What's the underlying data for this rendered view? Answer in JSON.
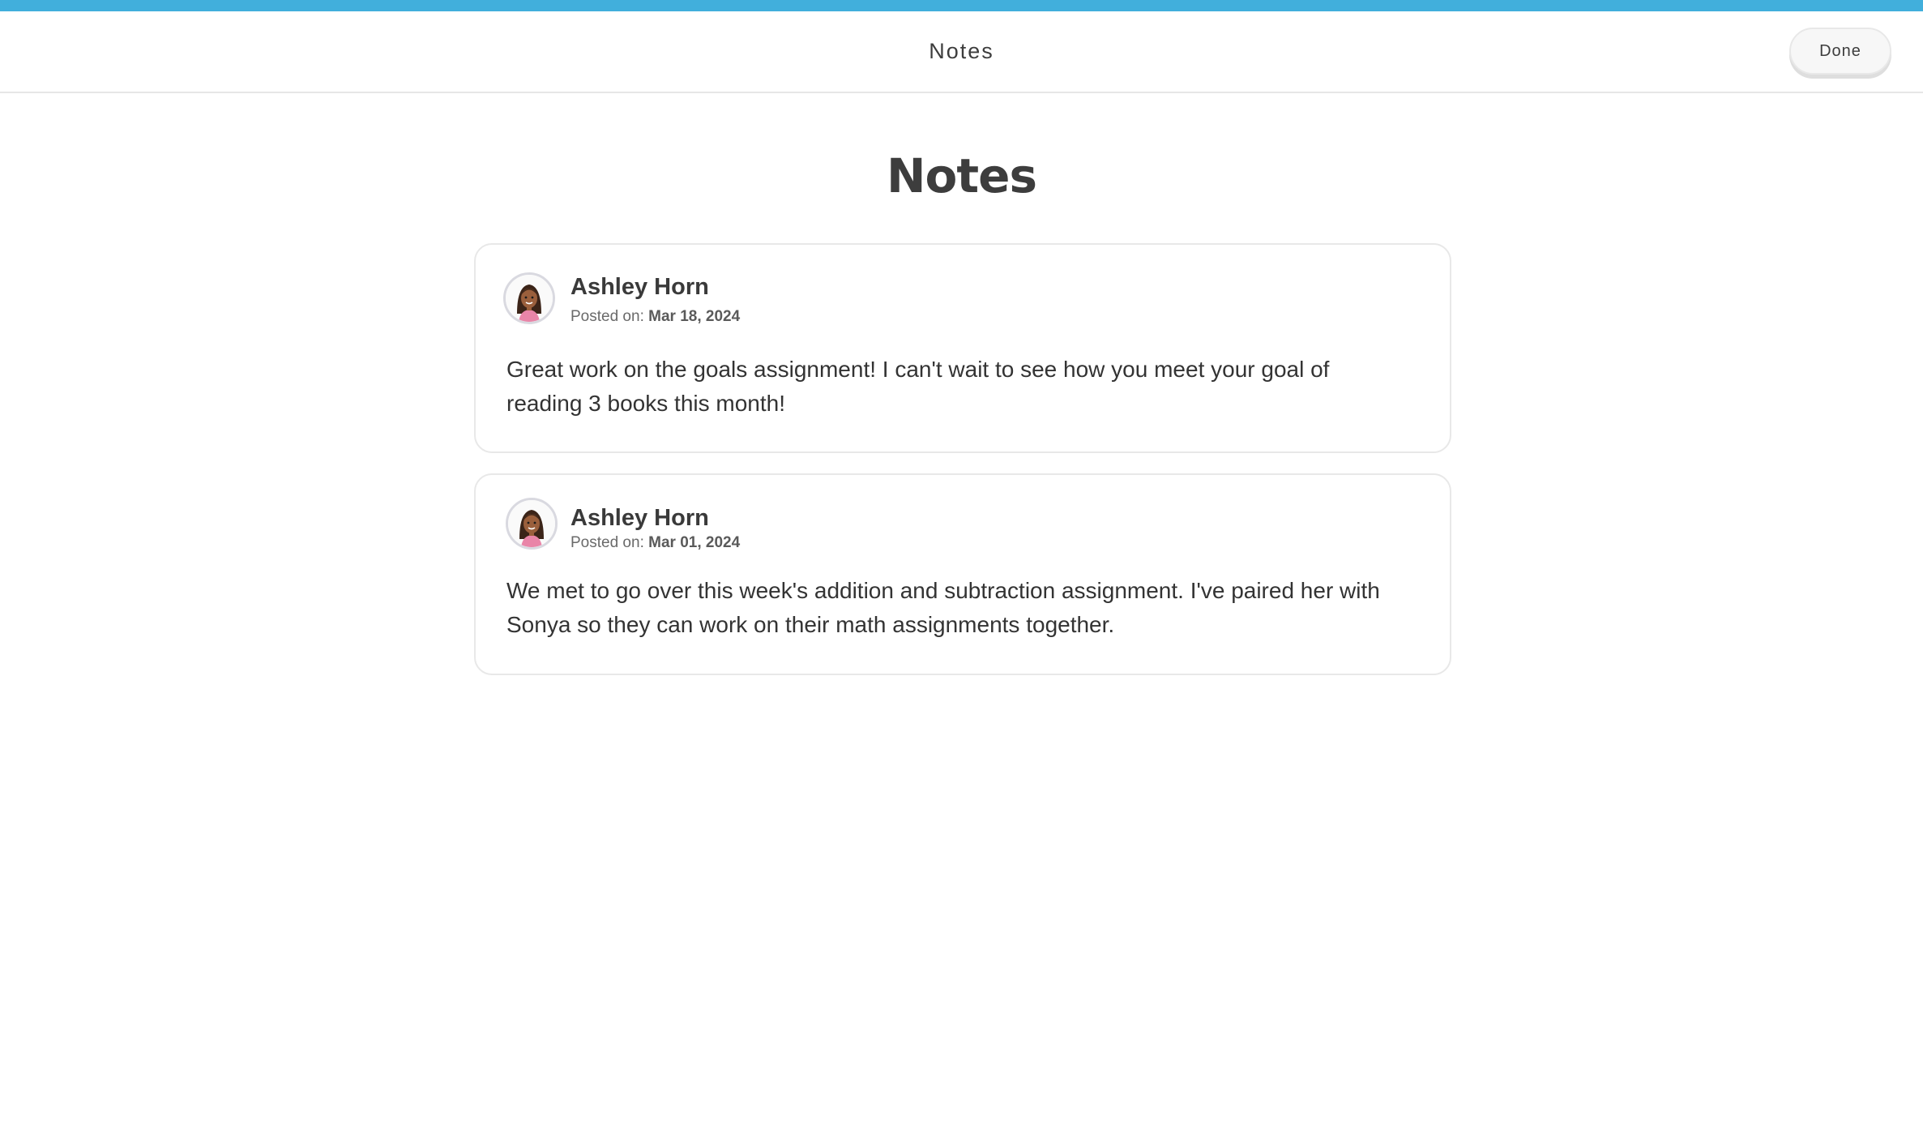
{
  "header": {
    "title": "Notes",
    "done_label": "Done"
  },
  "page": {
    "heading": "Notes"
  },
  "colors": {
    "accent_bar": "#41afdc"
  },
  "notes": [
    {
      "author": "Ashley Horn",
      "posted_prefix": "Posted on:",
      "date": "Mar 18, 2024",
      "body": "Great work on the goals assignment! I can't wait to see how you meet your goal of reading 3 books this month!",
      "avatar_icon": "student-avatar-icon"
    },
    {
      "author": "Ashley Horn",
      "posted_prefix": "Posted on:",
      "date": "Mar 01, 2024",
      "body": "We met to go over this week's addition and subtraction assignment. I've paired her with Sonya so they can work on their math assignments together.",
      "avatar_icon": "student-avatar-icon"
    }
  ]
}
